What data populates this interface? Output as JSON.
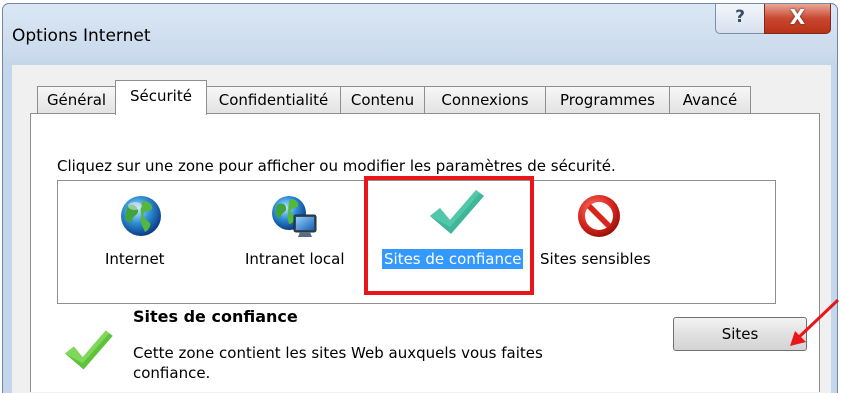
{
  "window": {
    "title": "Options Internet",
    "help_glyph": "?",
    "close_glyph": "X"
  },
  "tabs": [
    {
      "label": "Général"
    },
    {
      "label": "Sécurité"
    },
    {
      "label": "Confidentialité"
    },
    {
      "label": "Contenu"
    },
    {
      "label": "Connexions"
    },
    {
      "label": "Programmes"
    },
    {
      "label": "Avancé"
    }
  ],
  "active_tab": "Sécurité",
  "security": {
    "instruction": "Cliquez sur une zone pour afficher ou modifier les paramètres de sécurité.",
    "zones": [
      {
        "label": "Internet",
        "icon": "globe-icon"
      },
      {
        "label": "Intranet local",
        "icon": "intranet-globe-icon"
      },
      {
        "label": "Sites de confiance",
        "icon": "checkmark-icon",
        "selected": true
      },
      {
        "label": "Sites sensibles",
        "icon": "prohibited-icon"
      }
    ],
    "selected_zone": {
      "title": "Sites de confiance",
      "description": "Cette zone contient les sites Web auxquels vous faites confiance."
    },
    "sites_button": "Sites"
  },
  "colors": {
    "highlight": "#e8161a",
    "selection": "#3399ff",
    "arrow": "#e8161a",
    "check": "#3fb59a"
  }
}
